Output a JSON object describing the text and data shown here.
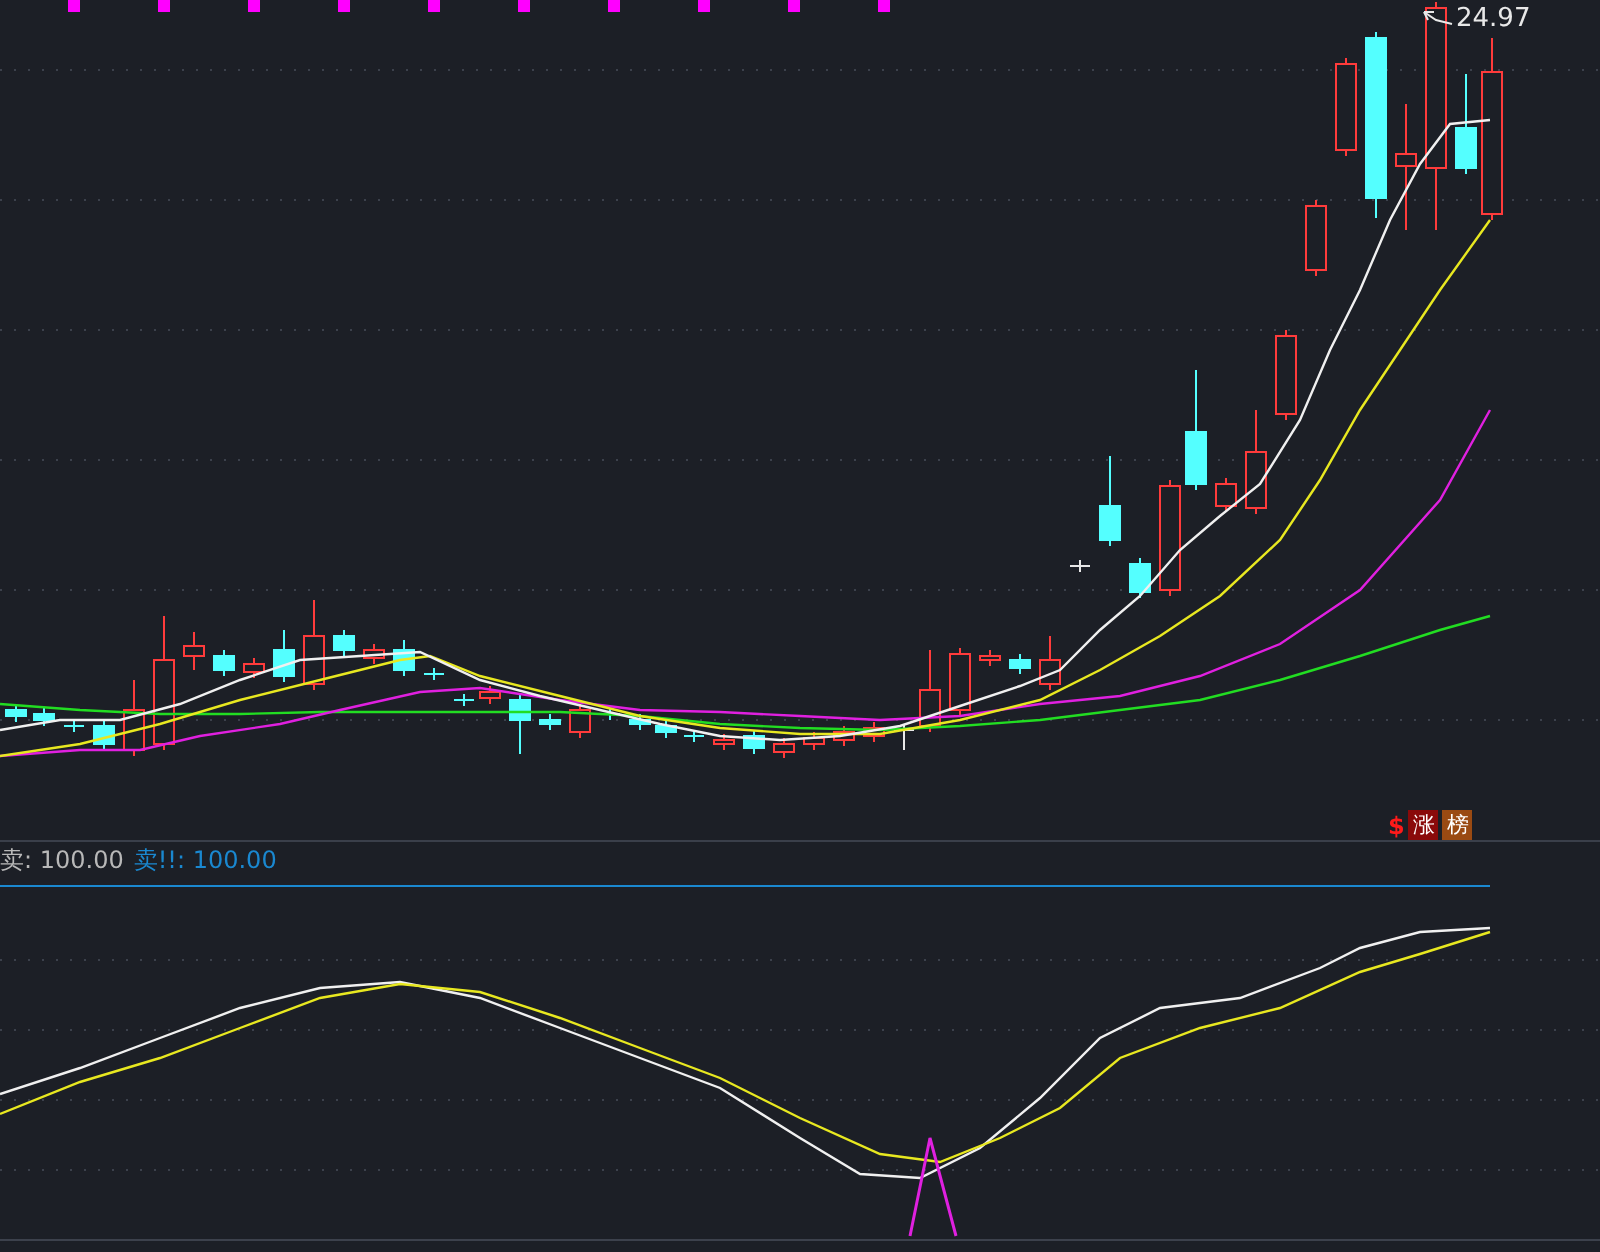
{
  "price_label": "24.97",
  "signal_symbol": "$",
  "badges": [
    {
      "text": "涨",
      "color": "#8a0a0a"
    },
    {
      "text": "榜",
      "color": "#9a4a12"
    }
  ],
  "indicator_values": [
    {
      "label": "卖: 100.00",
      "color": "#b8b8b8"
    },
    {
      "label": "卖!!: 100.00",
      "color": "#1a88d0"
    }
  ]
}
